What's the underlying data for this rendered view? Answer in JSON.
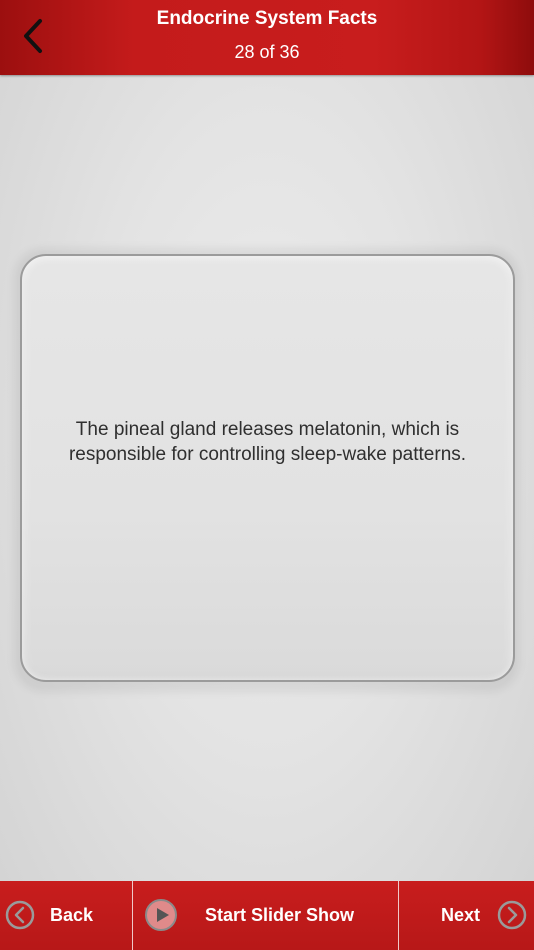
{
  "header": {
    "title": "Endocrine System Facts",
    "counter": "28 of 36",
    "back_icon": "chevron-left-icon"
  },
  "card": {
    "text": "The pineal gland releases melatonin, which is responsible for controlling sleep-wake patterns."
  },
  "footer": {
    "back_label": "Back",
    "back_icon": "chevron-left-circle-icon",
    "slideshow_label": "Start Slider Show",
    "slideshow_icon": "play-circle-icon",
    "next_label": "Next",
    "next_icon": "chevron-right-circle-icon"
  },
  "colors": {
    "brand_red": "#c41b1b",
    "dark_red": "#8e0c0c",
    "background": "#e3e3e3",
    "text": "#2f2f2f"
  }
}
